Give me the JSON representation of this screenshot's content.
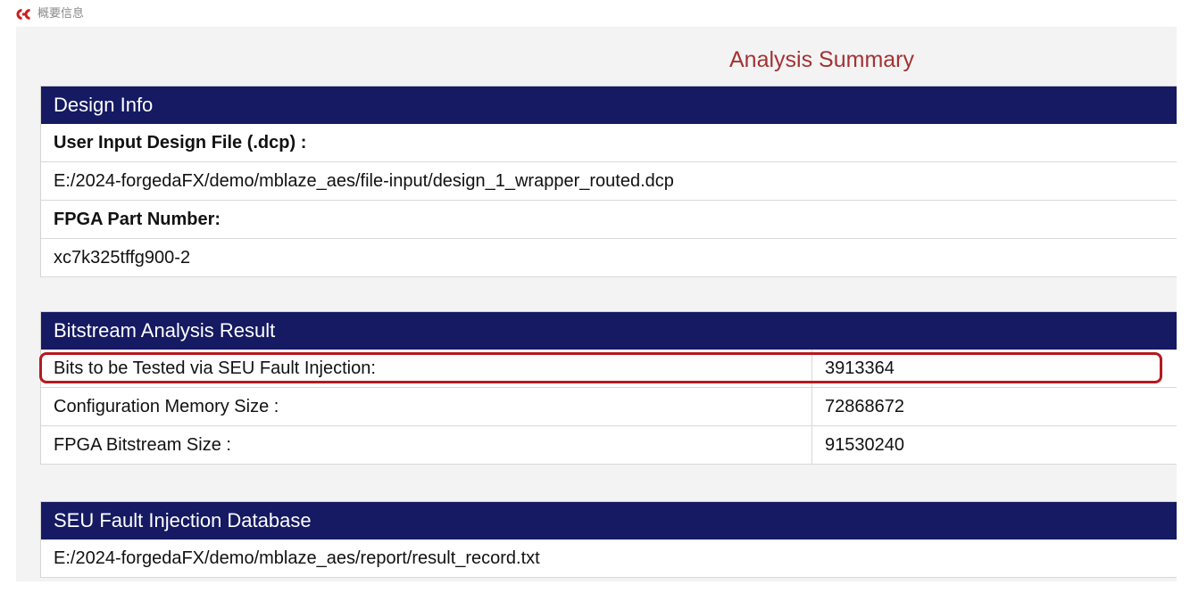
{
  "tab": {
    "label": "概要信息",
    "logo_icon": "app-logo-icon",
    "logo_color": "#cc1f1f"
  },
  "title": "Analysis Summary",
  "colors": {
    "header_bg": "#151a62",
    "title": "#a33234",
    "highlight": "#b51a1f"
  },
  "design_info": {
    "header": "Design Info",
    "rows": [
      {
        "text": "User Input Design File (.dcp) :",
        "bold": true
      },
      {
        "text": "E:/2024-forgedaFX/demo/mblaze_aes/file-input/design_1_wrapper_routed.dcp",
        "bold": false
      },
      {
        "text": "FPGA Part Number:",
        "bold": true
      },
      {
        "text": "xc7k325tffg900-2",
        "bold": false
      }
    ]
  },
  "bitstream": {
    "header": "Bitstream Analysis Result",
    "rows": [
      {
        "label": "Bits to be Tested via SEU Fault Injection:",
        "value": "3913364"
      },
      {
        "label": "Configuration Memory Size :",
        "value": "72868672"
      },
      {
        "label": "FPGA Bitstream Size :",
        "value": "91530240"
      }
    ]
  },
  "database": {
    "header": "SEU Fault Injection Database",
    "path": "E:/2024-forgedaFX/demo/mblaze_aes/report/result_record.txt"
  }
}
